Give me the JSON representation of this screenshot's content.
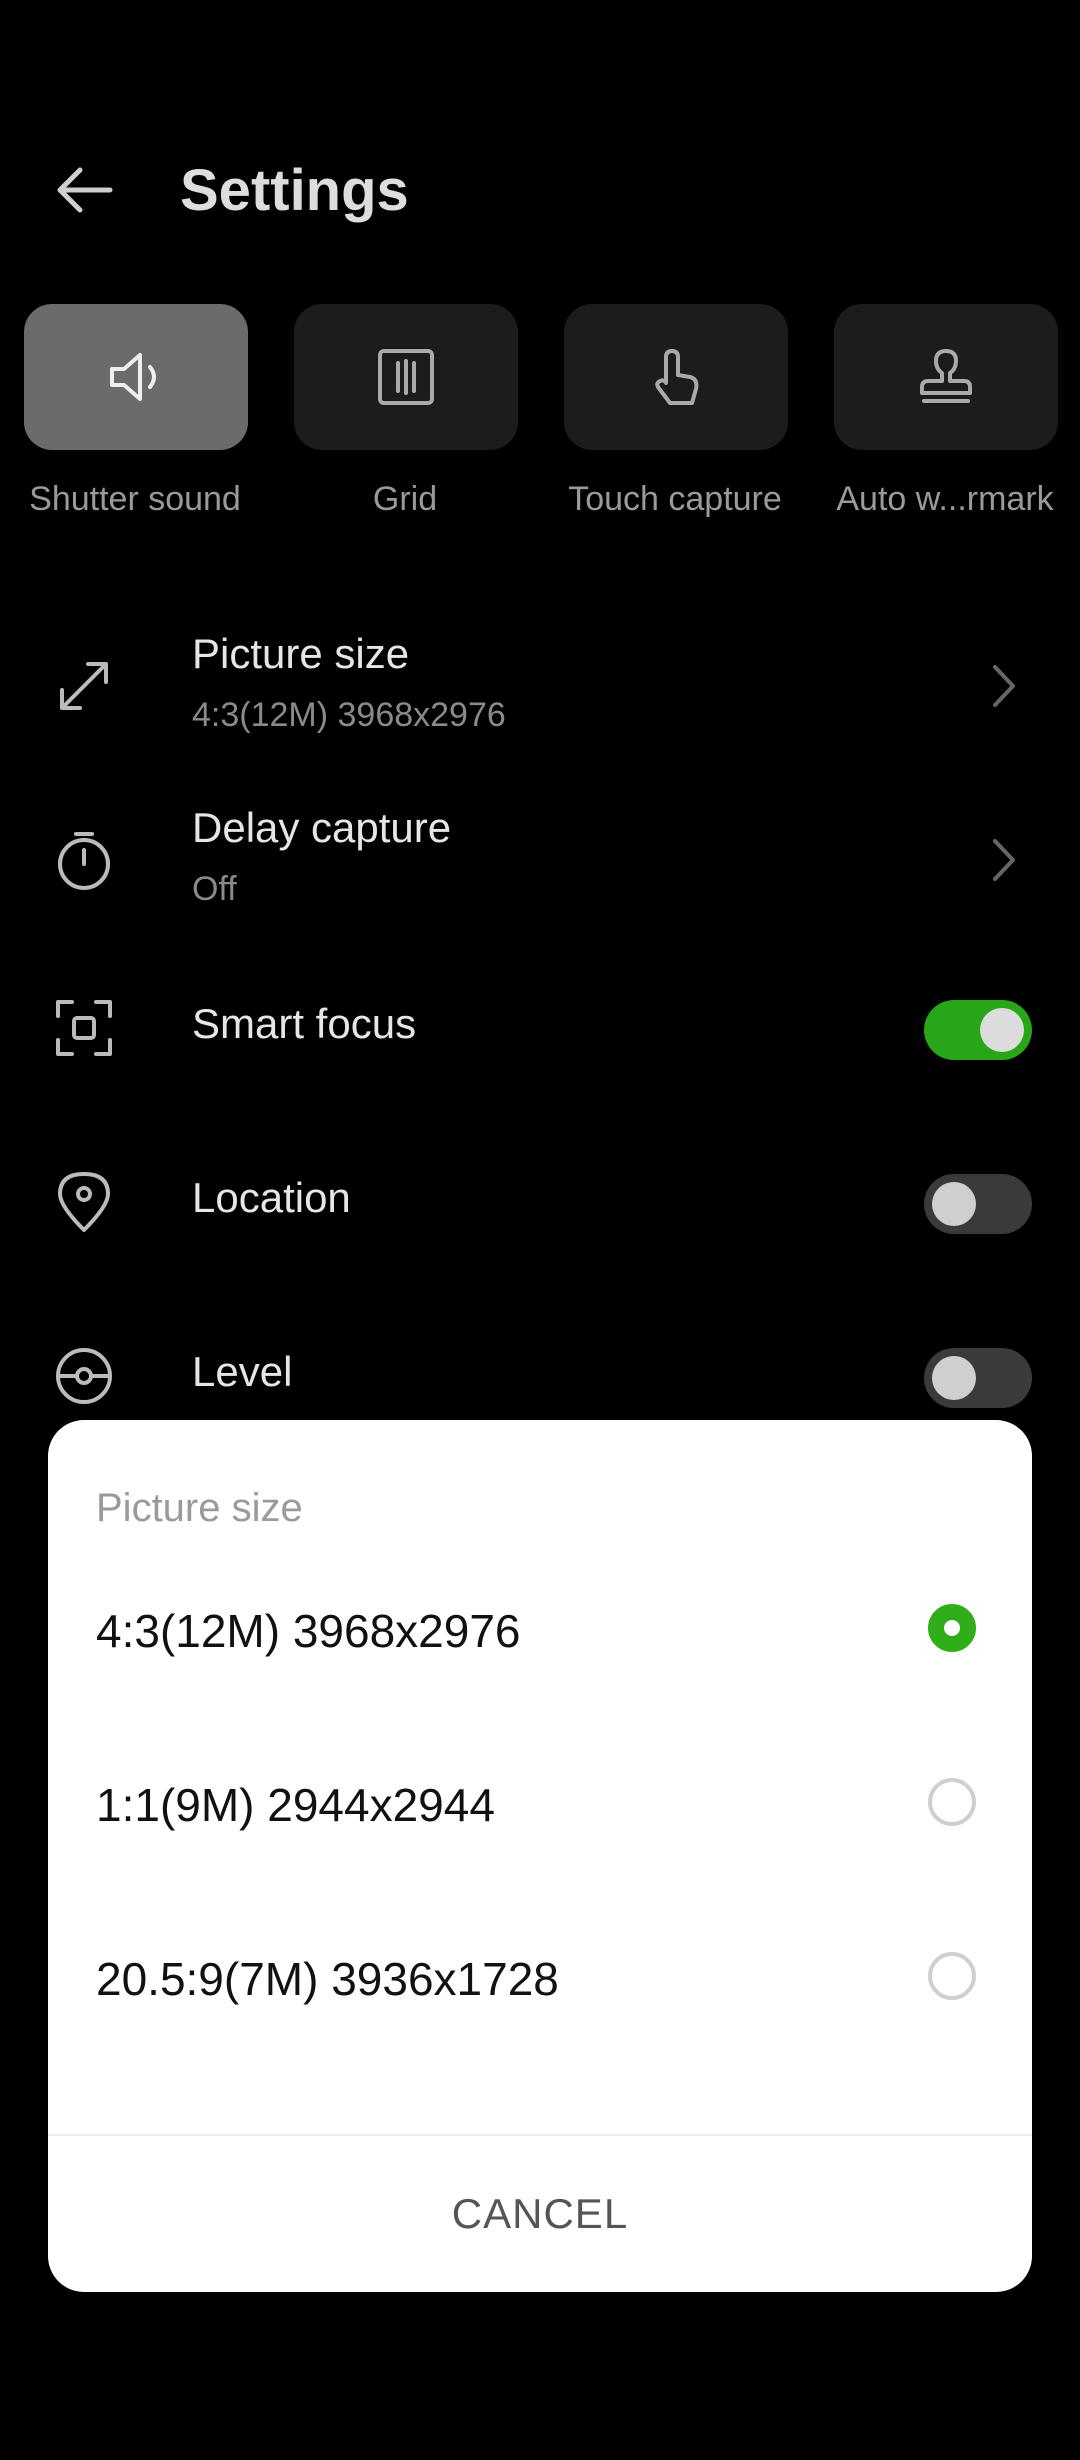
{
  "header": {
    "title": "Settings"
  },
  "quick_settings": [
    {
      "label": "Shutter sound",
      "icon": "speaker-icon",
      "active": true
    },
    {
      "label": "Grid",
      "icon": "grid-icon",
      "active": false
    },
    {
      "label": "Touch capture",
      "icon": "touch-icon",
      "active": false
    },
    {
      "label": "Auto w...rmark",
      "icon": "stamp-icon",
      "active": false
    }
  ],
  "settings": {
    "picture_size": {
      "label": "Picture size",
      "value": "4:3(12M) 3968x2976",
      "icon": "resize-icon"
    },
    "delay_capture": {
      "label": "Delay capture",
      "value": "Off",
      "icon": "timer-icon"
    },
    "smart_focus": {
      "label": "Smart focus",
      "on": true,
      "icon": "focus-icon"
    },
    "location": {
      "label": "Location",
      "on": false,
      "icon": "location-pin-icon"
    },
    "level": {
      "label": "Level",
      "on": false,
      "icon": "level-icon"
    }
  },
  "dialog": {
    "title": "Picture size",
    "options": [
      {
        "label": "4:3(12M) 3968x2976",
        "selected": true
      },
      {
        "label": "1:1(9M) 2944x2944",
        "selected": false
      },
      {
        "label": "20.5:9(7M) 3936x1728",
        "selected": false
      }
    ],
    "cancel_label": "CANCEL"
  },
  "colors": {
    "accent_green": "#2fae1a",
    "toggle_on": "#27a617",
    "background": "#000000",
    "dialog_bg": "#ffffff"
  }
}
